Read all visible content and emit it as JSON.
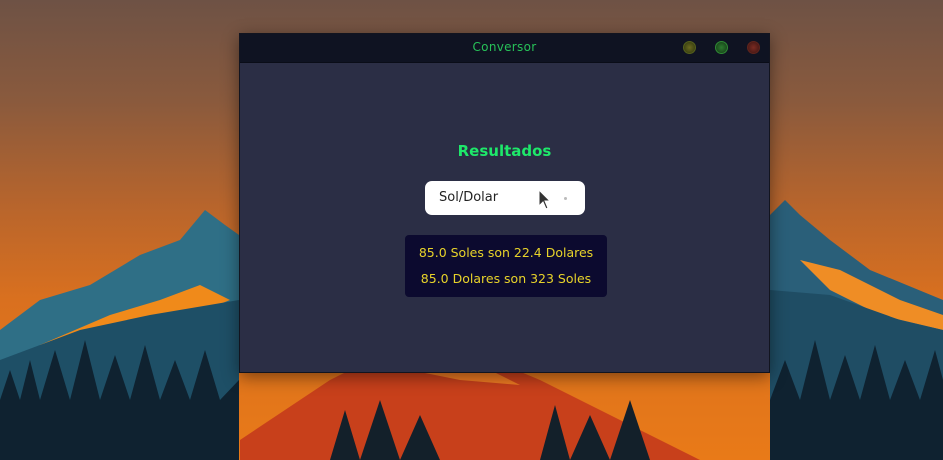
{
  "window": {
    "title": "Conversor"
  },
  "main": {
    "heading": "Resultados",
    "select": {
      "value": "Sol/Dolar"
    },
    "results": [
      "85.0 Soles son 22.4 Dolares",
      "85.0 Dolares son 323 Soles"
    ]
  },
  "colors": {
    "title_text": "#27c158",
    "heading_text": "#1ee86a",
    "result_text": "#e8d32a",
    "window_bg": "#2b2e45",
    "results_bg": "#0c0a2f"
  },
  "icons": {
    "cursor": "mouse-pointer-icon"
  }
}
